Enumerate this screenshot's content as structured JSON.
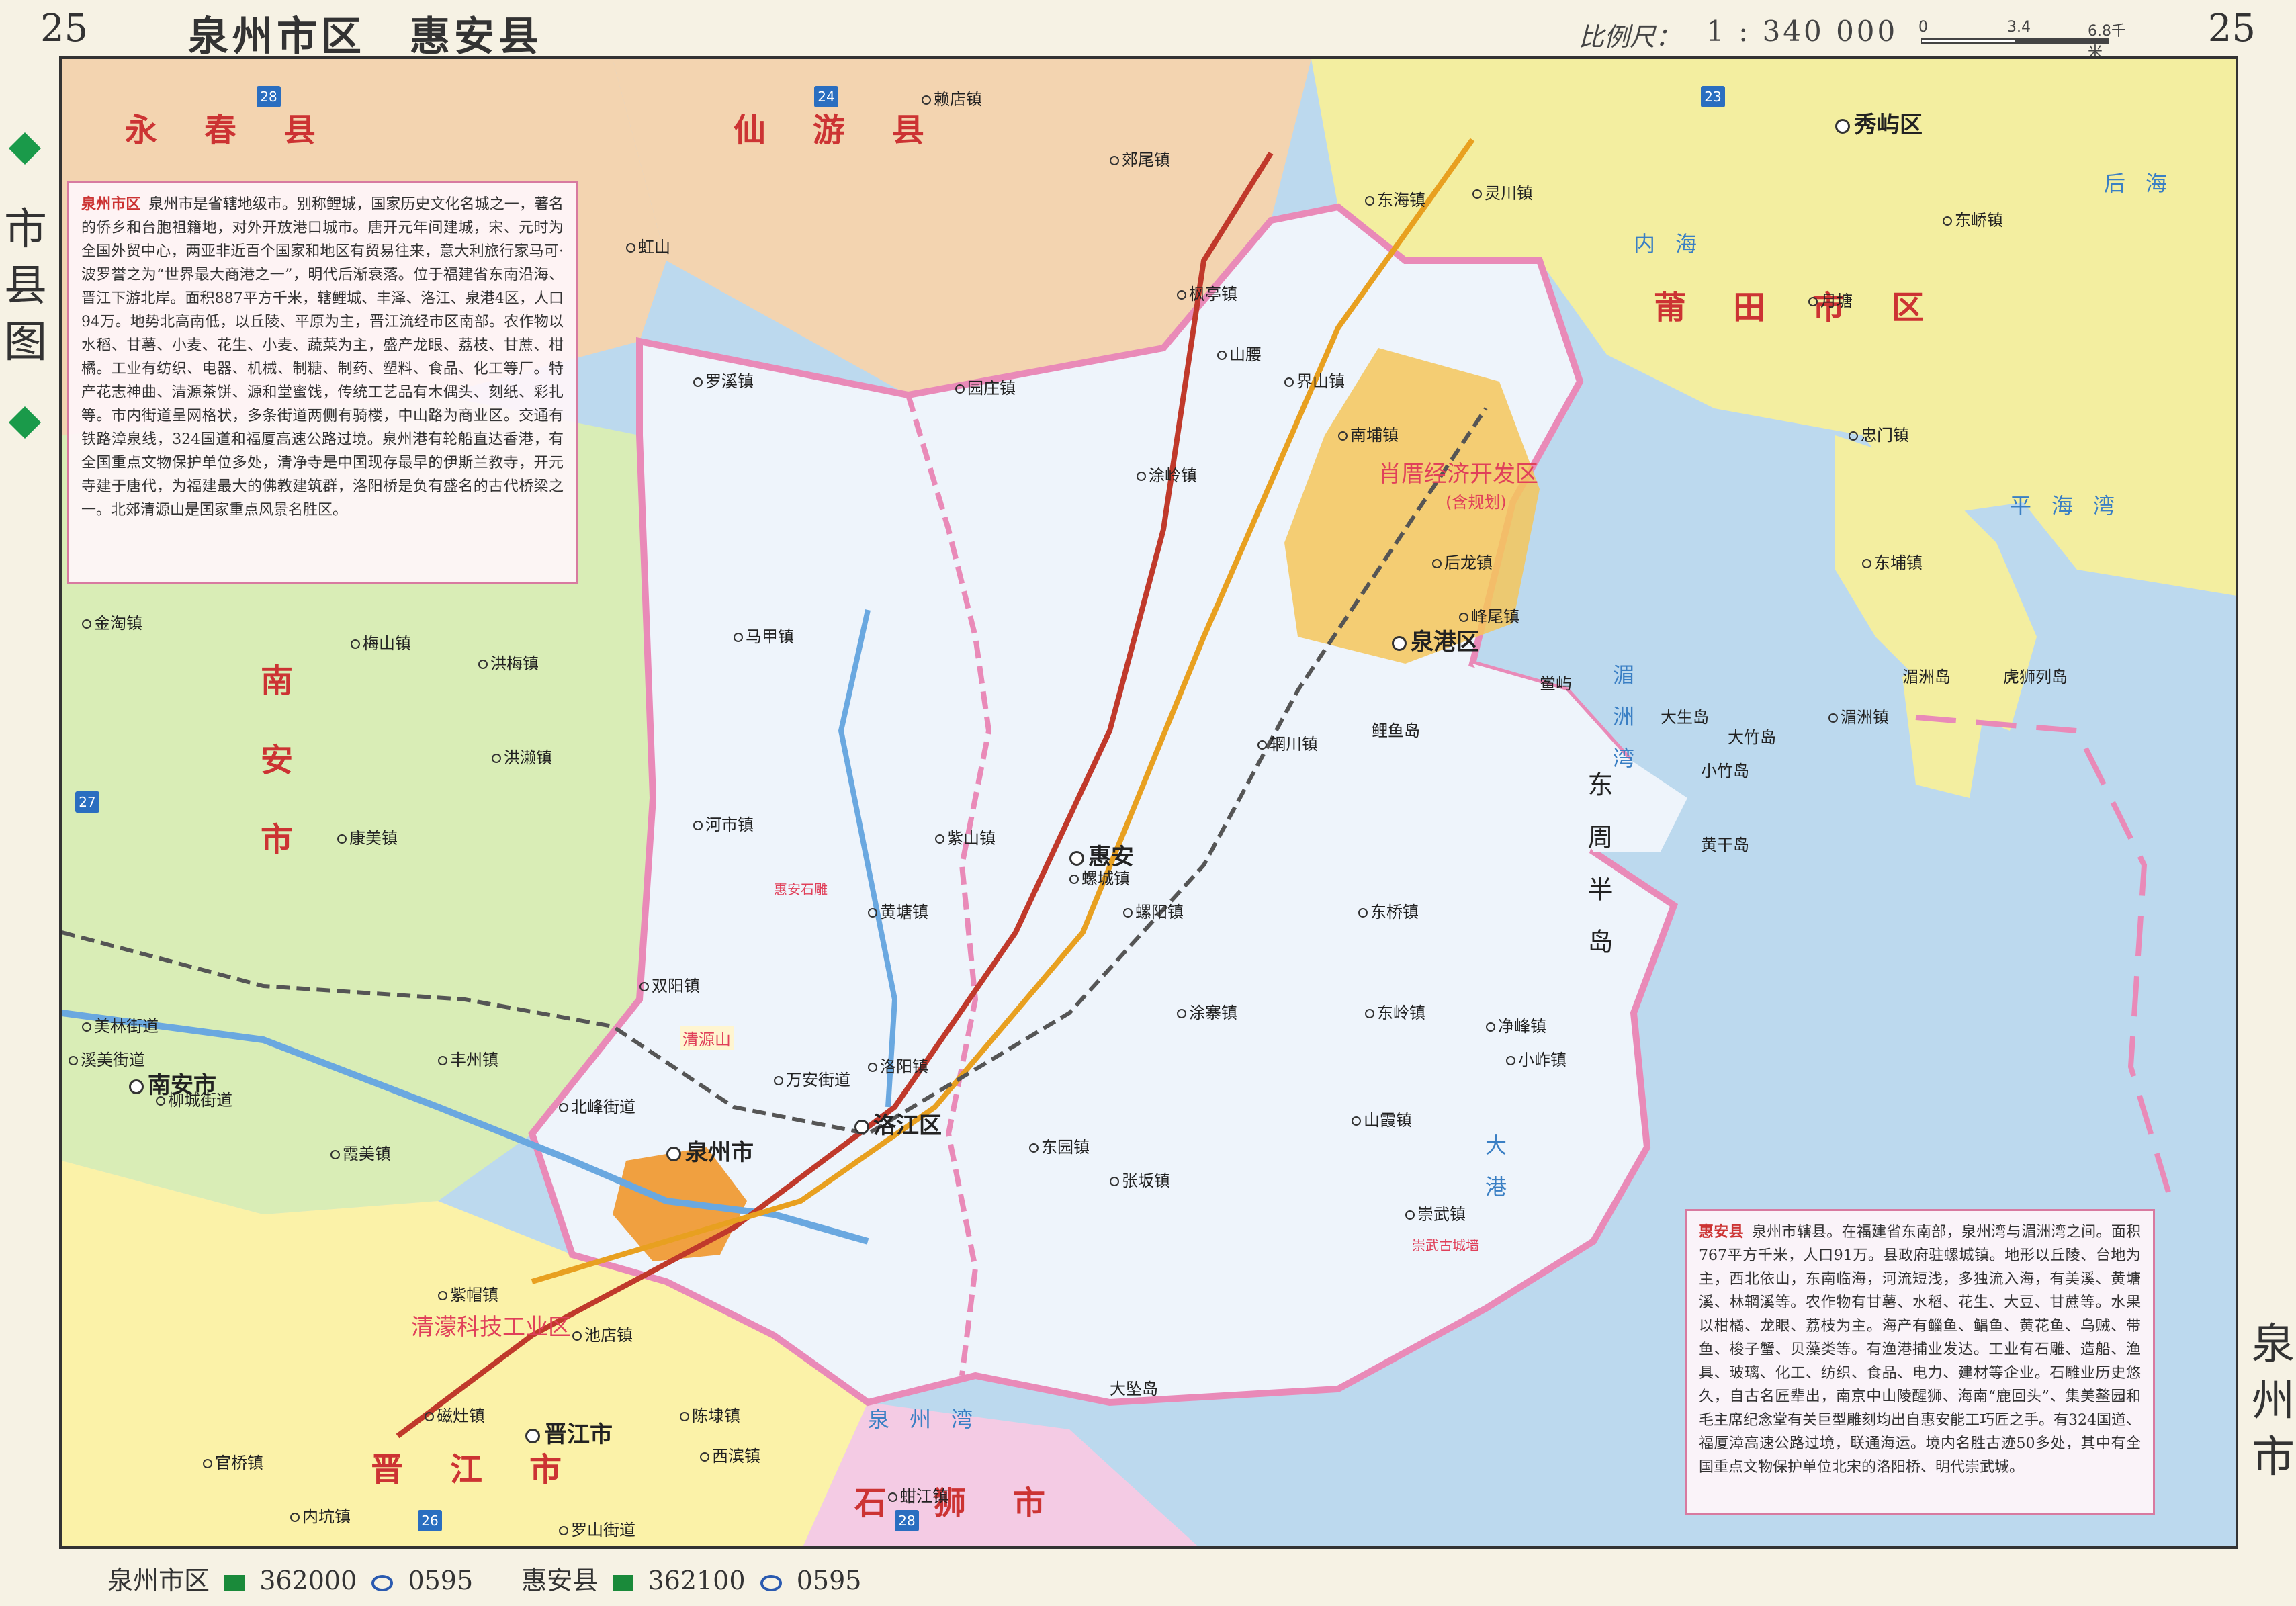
{
  "header": {
    "page_num_left": "25",
    "page_num_right": "25",
    "title": "泉州市区　惠安县",
    "scale_label": "比例尺：",
    "scale_value": "1 : 340 000",
    "scale_ticks": [
      "0",
      "3.4",
      "6.8千米"
    ]
  },
  "sidebar": {
    "left_label": "市县图",
    "right_label": "泉州市"
  },
  "colors": {
    "sea": "#bcd9ee",
    "quanzhou_area": "#eef4fb",
    "yongchun": "#f3d4b0",
    "xianyou": "#f3d4b0",
    "nanan": "#d9edb6",
    "jinjiang": "#fbf2a8",
    "putian": "#f3eea0",
    "boundary_pink": "#e98ab8",
    "dev_zone": "#f5c55a",
    "river": "#6aa8e0"
  },
  "info_left": {
    "title": "泉州市区",
    "text": "泉州市是省辖地级市。别称鲤城，国家历史文化名城之一，著名的侨乡和台胞祖籍地，对外开放港口城市。唐开元年间建城，宋、元时为全国外贸中心，两亚非近百个国家和地区有贸易往来，意大利旅行家马可·波罗誉之为“世界最大商港之一”，明代后渐衰落。位于福建省东南沿海、晋江下游北岸。面积887平方千米，辖鲤城、丰泽、洛江、泉港4区，人口94万。地势北高南低，以丘陵、平原为主，晋江流经市区南部。农作物以水稻、甘薯、小麦、花生、小麦、蔬菜为主，盛产龙眼、荔枝、甘蔗、柑橘。工业有纺织、电器、机械、制糖、制药、塑料、食品、化工等厂。特产花志神曲、清源茶饼、源和堂蜜饯，传统工艺品有木偶头、刻纸、彩扎等。市内街道呈网格状，多条街道两侧有骑楼，中山路为商业区。交通有铁路漳泉线，324国道和福厦高速公路过境。泉州港有轮船直达香港，有全国重点文物保护单位多处，清净寺是中国现存最早的伊斯兰教寺，开元寺建于唐代，为福建最大的佛教建筑群，洛阳桥是负有盛名的古代桥梁之一。北郊清源山是国家重点风景名胜区。"
  },
  "info_right": {
    "title": "惠安县",
    "text": "泉州市辖县。在福建省东南部，泉州湾与湄洲湾之间。面积767平方千米，人口91万。县政府驻螺城镇。地形以丘陵、台地为主，西北依山，东南临海，河流短浅，多独流入海，有美溪、黄塘溪、林辋溪等。农作物有甘薯、水稻、花生、大豆、甘蔗等。水果以柑橘、龙眼、荔枝为主。海产有鲻鱼、鲳鱼、黄花鱼、乌贼、带鱼、梭子蟹、贝藻类等。有渔港捕业发达。工业有石雕、造船、渔具、玻璃、化工、纺织、食品、电力、建材等企业。石雕业历史悠久，自古名匠辈出，南京中山陵醒狮、海南“鹿回头”、集美鳌园和毛主席纪念堂有关巨型雕刻均出自惠安能工巧匠之手。有324国道、福厦漳高速公路过境，联通海运。境内名胜古迹50多处，其中有全国重点文物保护单位北宋的洛阳桥、明代崇武城。"
  },
  "footer": {
    "quanzhou_name": "泉州市区",
    "quanzhou_post": "362000",
    "quanzhou_phone": "0595",
    "huian_name": "惠安县",
    "huian_post": "362100",
    "huian_phone": "0595"
  },
  "map": {
    "regions": [
      {
        "label": "永春县"
      },
      {
        "label": "仙游县"
      },
      {
        "label": "南安市"
      },
      {
        "label": "晋江市"
      },
      {
        "label": "石狮市"
      },
      {
        "label": "莆田市区"
      }
    ],
    "waters": [
      {
        "label": "泉州湾"
      },
      {
        "label": "湄洲湾"
      },
      {
        "label": "大港"
      },
      {
        "label": "平海湾"
      },
      {
        "label": "后海"
      },
      {
        "label": "内海"
      }
    ],
    "peninsula": "东周半岛",
    "dev_zone": "肖厝经济开发区",
    "dev_zone_sub": "(含规划)",
    "industrial_zone": "清濛科技工业区",
    "cities": [
      {
        "name": "泉州市"
      },
      {
        "name": "惠安"
      },
      {
        "name": "南安市"
      },
      {
        "name": "晋江市"
      },
      {
        "name": "泉港区"
      },
      {
        "name": "洛江区"
      },
      {
        "name": "秀屿区"
      }
    ],
    "towns": [
      {
        "name": "赖店镇"
      },
      {
        "name": "郊尾镇"
      },
      {
        "name": "东海镇"
      },
      {
        "name": "灵川镇"
      },
      {
        "name": "东峤镇"
      },
      {
        "name": "枫亭镇"
      },
      {
        "name": "园庄镇"
      },
      {
        "name": "界山镇"
      },
      {
        "name": "南埔镇"
      },
      {
        "name": "涂岭镇"
      },
      {
        "name": "后龙镇"
      },
      {
        "name": "峰尾镇"
      },
      {
        "name": "山腰"
      },
      {
        "name": "马甲镇"
      },
      {
        "name": "河市镇"
      },
      {
        "name": "双阳镇"
      },
      {
        "name": "罗溪镇"
      },
      {
        "name": "虹山"
      },
      {
        "name": "紫山镇"
      },
      {
        "name": "黄塘镇"
      },
      {
        "name": "螺城镇"
      },
      {
        "name": "螺阳镇"
      },
      {
        "name": "涂寨镇"
      },
      {
        "name": "东岭镇"
      },
      {
        "name": "山霞镇"
      },
      {
        "name": "崇武镇"
      },
      {
        "name": "张坂镇"
      },
      {
        "name": "东园镇"
      },
      {
        "name": "净峰镇"
      },
      {
        "name": "小岞镇"
      },
      {
        "name": "辋川镇"
      },
      {
        "name": "东桥镇"
      },
      {
        "name": "洛阳镇"
      },
      {
        "name": "万安街道"
      },
      {
        "name": "北峰街道"
      },
      {
        "name": "金淘镇"
      },
      {
        "name": "梅山镇"
      },
      {
        "name": "洪梅镇"
      },
      {
        "name": "洪濑镇"
      },
      {
        "name": "康美镇"
      },
      {
        "name": "美林街道"
      },
      {
        "name": "溪美街道"
      },
      {
        "name": "柳城街道"
      },
      {
        "name": "丰州镇"
      },
      {
        "name": "霞美镇"
      },
      {
        "name": "紫帽镇"
      },
      {
        "name": "池店镇"
      },
      {
        "name": "磁灶镇"
      },
      {
        "name": "陈埭镇"
      },
      {
        "name": "西滨镇"
      },
      {
        "name": "内坑镇"
      },
      {
        "name": "罗山街道"
      },
      {
        "name": "官桥镇"
      },
      {
        "name": "蚶江镇"
      },
      {
        "name": "忠门镇"
      },
      {
        "name": "东埔镇"
      },
      {
        "name": "湄洲镇"
      },
      {
        "name": "月塘"
      }
    ],
    "islands": [
      {
        "name": "大生岛"
      },
      {
        "name": "大竹岛"
      },
      {
        "name": "小竹岛"
      },
      {
        "name": "鲤鱼岛"
      },
      {
        "name": "湄洲岛"
      },
      {
        "name": "虎狮列岛"
      },
      {
        "name": "大坠岛"
      },
      {
        "name": "黄干岛"
      },
      {
        "name": "鲎屿"
      }
    ],
    "highway_shields": [
      "28",
      "24",
      "23",
      "27",
      "26",
      "28"
    ],
    "landmarks": [
      {
        "name": "清源山"
      },
      {
        "name": "惠安石雕"
      },
      {
        "name": "崇武古城墙"
      }
    ]
  }
}
